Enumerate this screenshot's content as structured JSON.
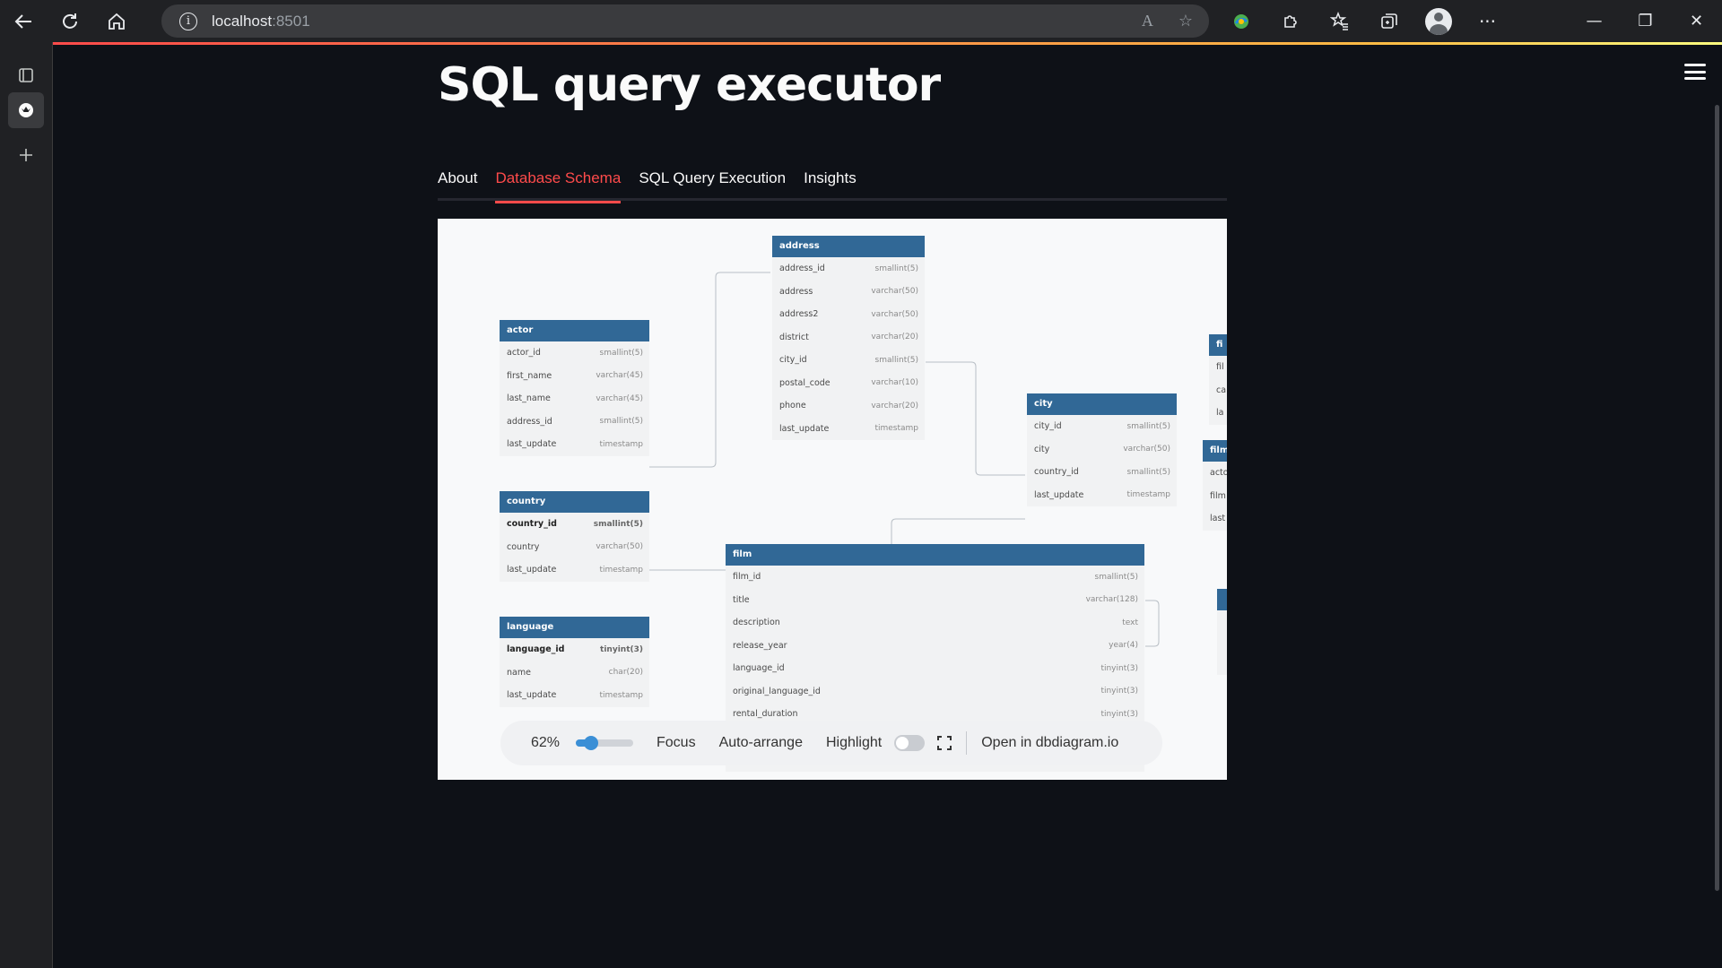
{
  "browser": {
    "url_host": "localhost",
    "url_port": ":8501",
    "read_aloud_glyph": "A",
    "icons": [
      "back-icon",
      "refresh-icon",
      "home-icon",
      "info-icon",
      "read-aloud-icon",
      "add-favorite-icon",
      "extension-icon",
      "puzzle-icon",
      "favorites-icon",
      "collections-icon",
      "profile-icon",
      "more-icon"
    ]
  },
  "window": {
    "minimize": "—",
    "restore": "❐",
    "close": "✕"
  },
  "app": {
    "title": "SQL query executor",
    "tabs": [
      "About",
      "Database Schema",
      "SQL Query Execution",
      "Insights"
    ],
    "active_tab": 1
  },
  "diagram": {
    "tables": {
      "address": {
        "name": "address",
        "rows": [
          [
            "address_id",
            "smallint(5)"
          ],
          [
            "address",
            "varchar(50)"
          ],
          [
            "address2",
            "varchar(50)"
          ],
          [
            "district",
            "varchar(20)"
          ],
          [
            "city_id",
            "smallint(5)"
          ],
          [
            "postal_code",
            "varchar(10)"
          ],
          [
            "phone",
            "varchar(20)"
          ],
          [
            "last_update",
            "timestamp"
          ]
        ]
      },
      "actor": {
        "name": "actor",
        "rows": [
          [
            "actor_id",
            "smallint(5)"
          ],
          [
            "first_name",
            "varchar(45)"
          ],
          [
            "last_name",
            "varchar(45)"
          ],
          [
            "address_id",
            "smallint(5)"
          ],
          [
            "last_update",
            "timestamp"
          ]
        ]
      },
      "city": {
        "name": "city",
        "rows": [
          [
            "city_id",
            "smallint(5)"
          ],
          [
            "city",
            "varchar(50)"
          ],
          [
            "country_id",
            "smallint(5)"
          ],
          [
            "last_update",
            "timestamp"
          ]
        ]
      },
      "country": {
        "name": "country",
        "rows": [
          [
            "country_id",
            "smallint(5)"
          ],
          [
            "country",
            "varchar(50)"
          ],
          [
            "last_update",
            "timestamp"
          ]
        ]
      },
      "language": {
        "name": "language",
        "rows": [
          [
            "language_id",
            "tinyint(3)"
          ],
          [
            "name",
            "char(20)"
          ],
          [
            "last_update",
            "timestamp"
          ]
        ]
      },
      "film": {
        "name": "film",
        "rows": [
          [
            "film_id",
            "smallint(5)"
          ],
          [
            "title",
            "varchar(128)"
          ],
          [
            "description",
            "text"
          ],
          [
            "release_year",
            "year(4)"
          ],
          [
            "language_id",
            "tinyint(3)"
          ],
          [
            "original_language_id",
            "tinyint(3)"
          ],
          [
            "rental_duration",
            "tinyint(3)"
          ]
        ]
      },
      "clipped_a": {
        "name": "fi",
        "rows": [
          [
            "fil",
            ""
          ],
          [
            "ca",
            ""
          ],
          [
            "la",
            ""
          ]
        ]
      },
      "clipped_b": {
        "name": "film",
        "rows": [
          [
            "acto",
            ""
          ],
          [
            "film",
            ""
          ],
          [
            "last",
            ""
          ]
        ]
      }
    },
    "controls": {
      "zoom": "62%",
      "zoom_level": 0.62,
      "focus": "Focus",
      "auto_arrange": "Auto-arrange",
      "highlight": "Highlight",
      "highlight_on": false,
      "open_link": "Open in dbdiagram.io"
    }
  }
}
